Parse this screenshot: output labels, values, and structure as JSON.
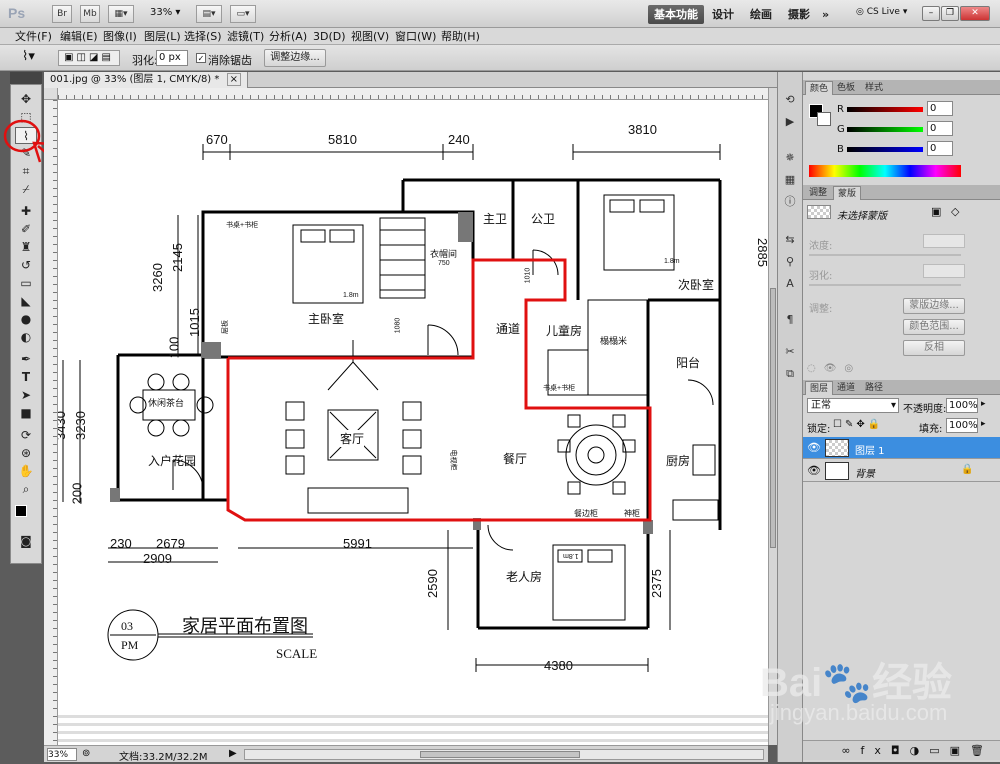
{
  "app": {
    "logo": "Ps",
    "zoom": "33%",
    "toolbar_buttons": [
      "Br",
      "Mb"
    ],
    "workspaces": [
      "基本功能",
      "设计",
      "绘画",
      "摄影"
    ],
    "more": "»",
    "cslive": "CS Live",
    "more_chevron": "▾"
  },
  "menu": [
    "文件(F)",
    "编辑(E)",
    "图像(I)",
    "图层(L)",
    "选择(S)",
    "滤镜(T)",
    "分析(A)",
    "3D(D)",
    "视图(V)",
    "窗口(W)",
    "帮助(H)"
  ],
  "options": {
    "feather_label": "羽化:",
    "feather_value": "0 px",
    "antialias_label": "消除锯齿",
    "refine_edge": "调整边缘..."
  },
  "document": {
    "tab_title": "001.jpg @ 33% (图层 1, CMYK/8) *",
    "tab_close": "×"
  },
  "status": {
    "zoom": "33%",
    "doc_info": "文档:33.2M/32.2M"
  },
  "plan": {
    "dims": {
      "d670": "670",
      "d5810": "5810",
      "d240": "240",
      "d3810": "3810",
      "d3260": "3260",
      "d2145": "2145",
      "d1015": "1015",
      "d100": "100",
      "d3430": "3430",
      "d3230": "3230",
      "d200": "200",
      "d230": "230",
      "d2679": "2679",
      "d2909": "2909",
      "d5991": "5991",
      "d2590": "2590",
      "d2375": "2375",
      "d4380": "4380",
      "d2885": "2885"
    },
    "rooms": {
      "master": "主卧室",
      "main_bath": "主卫",
      "public_bath": "公卫",
      "second": "次卧室",
      "closet": "衣帽间",
      "aisle": "通道",
      "kids": "儿童房",
      "tatami": "榻榻米",
      "balcony": "阳台",
      "living": "客厅",
      "dining": "餐厅",
      "kitchen": "厨房",
      "elder": "老人房",
      "garden": "入户花园",
      "tea": "休闲茶台",
      "desk1": "书桌+书柜",
      "desk2": "书桌+书柜",
      "sideboard": "餐边柜",
      "shrine": "神柜",
      "bed1": "1.8m",
      "bed2": "1.8m",
      "bed3": "1.8m",
      "n750": "750",
      "n1080": "1080",
      "n1010": "1010",
      "wall_label": "层板",
      "tv": "电视柜"
    },
    "title_num": "03",
    "title_pm": "PM",
    "title": "家居平面布置图",
    "scale": "SCALE"
  },
  "panels": {
    "color_tabs": [
      "颜色",
      "色板",
      "样式"
    ],
    "r_label": "R",
    "g_label": "G",
    "b_label": "B",
    "r_value": "0",
    "g_value": "0",
    "b_value": "0",
    "adjust_tabs": [
      "调整",
      "蒙版"
    ],
    "mask_title": "未选择蒙版",
    "density": "浓度:",
    "feather": "羽化:",
    "refine": "调整:",
    "mask_edge_btn": "蒙版边缘...",
    "color_range_btn": "颜色范围...",
    "invert_btn": "反相",
    "layer_tabs": [
      "图层",
      "通道",
      "路径"
    ],
    "blend_mode": "正常",
    "opacity_label": "不透明度:",
    "opacity_value": "100%",
    "lock_label": "锁定:",
    "fill_label": "填充:",
    "fill_value": "100%",
    "layers": [
      {
        "name": "图层 1",
        "selected": true
      },
      {
        "name": "背景",
        "selected": false
      }
    ]
  },
  "watermark": {
    "brand": "Bai",
    "brand2": "经验",
    "url": "jingyan.baidu.com"
  },
  "colors": {
    "accent_red": "#e01010",
    "selection_blue": "#3c8ee0"
  }
}
